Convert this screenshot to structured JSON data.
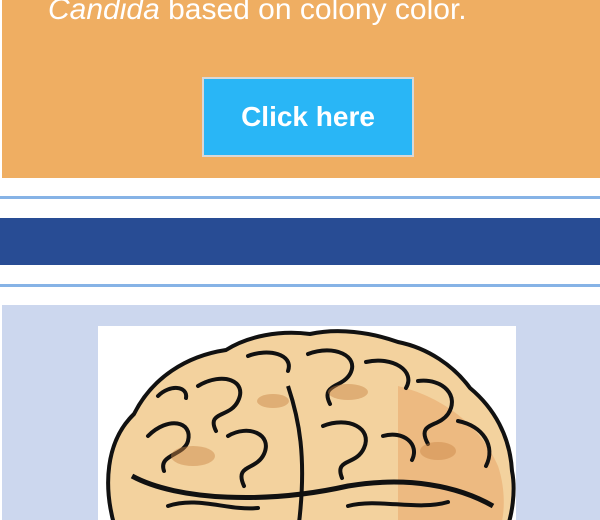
{
  "promo": {
    "text_italic": "Candida",
    "text_rest": " based on colony color.",
    "button_label": "Click here",
    "background": "#efae62",
    "button_color": "#29b6f6"
  },
  "divider": {
    "bar_color": "#284c94",
    "rule_color": "#86b3e6"
  },
  "image_section": {
    "background": "#ccd7ee",
    "image": "brain-illustration"
  }
}
